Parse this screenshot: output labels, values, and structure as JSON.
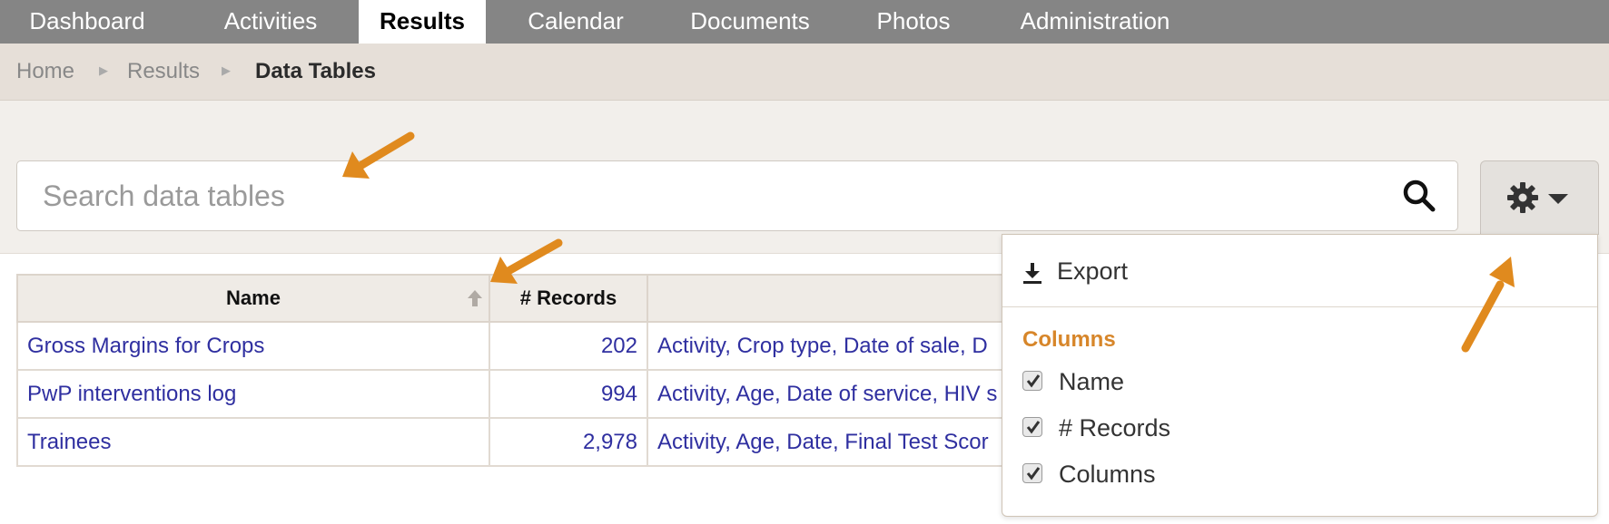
{
  "nav": {
    "tabs": [
      {
        "label": "Dashboard"
      },
      {
        "label": "Activities"
      },
      {
        "label": "Results"
      },
      {
        "label": "Calendar"
      },
      {
        "label": "Documents"
      },
      {
        "label": "Photos"
      },
      {
        "label": "Administration"
      }
    ],
    "active": "Results"
  },
  "breadcrumb": [
    "Home",
    "Results",
    "Data Tables"
  ],
  "search": {
    "placeholder": "Search data tables",
    "value": ""
  },
  "table": {
    "headers": [
      "Name",
      "# Records",
      ""
    ],
    "rows": [
      {
        "name": "Gross Margins for Crops",
        "records": "202",
        "columns": "Activity, Crop type, Date of sale, D"
      },
      {
        "name": "PwP interventions log",
        "records": "994",
        "columns": "Activity, Age, Date of service, HIV s"
      },
      {
        "name": "Trainees",
        "records": "2,978",
        "columns": "Activity, Age, Date, Final Test Scor"
      }
    ]
  },
  "menu": {
    "export_label": "Export",
    "columns_header": "Columns",
    "column_toggles": [
      {
        "label": "Name",
        "checked": true
      },
      {
        "label": "# Records",
        "checked": true
      },
      {
        "label": "Columns",
        "checked": true
      }
    ]
  },
  "colors": {
    "nav_bg": "#858585",
    "link": "#2f2fa0",
    "accent_orange": "#d7862a",
    "annotation_arrow": "#e08a1e"
  }
}
